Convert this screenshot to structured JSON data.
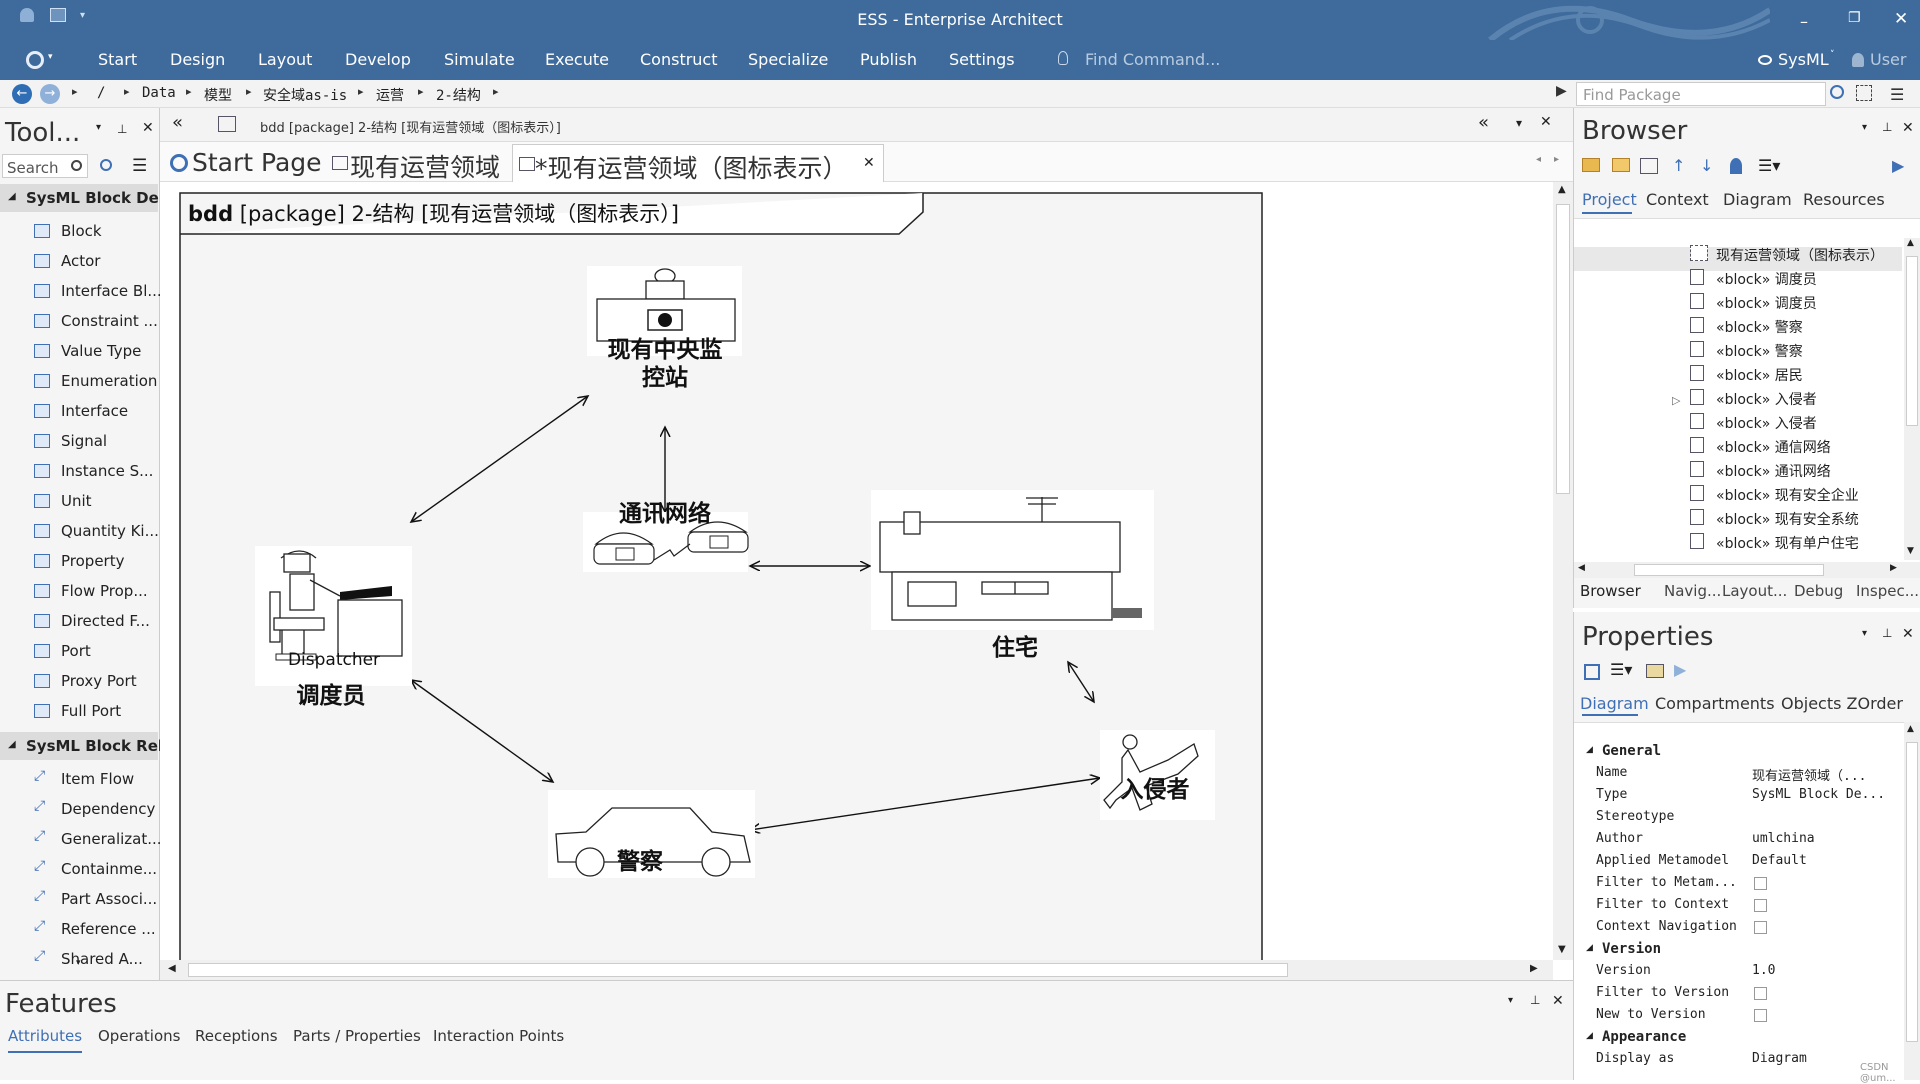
{
  "window": {
    "title": "ESS - Enterprise Architect"
  },
  "menu": {
    "items": [
      "Start",
      "Design",
      "Layout",
      "Develop",
      "Simulate",
      "Execute",
      "Construct",
      "Specialize",
      "Publish",
      "Settings"
    ],
    "find_command_placeholder": "Find Command...",
    "perspective": "SysML",
    "user": "User"
  },
  "breadcrumb": {
    "items": [
      "/",
      "Data",
      "模型",
      "安全域as-is",
      "运营",
      "2-结构"
    ]
  },
  "find_package": {
    "placeholder": "Find Package"
  },
  "toolbox": {
    "title": "Tool...",
    "search_placeholder": "Search",
    "section1": "SysML Block De...",
    "items1": [
      "Block",
      "Actor",
      "Interface Bl...",
      "Constraint ...",
      "Value Type",
      "Enumeration",
      "Interface",
      "Signal",
      "Instance S...",
      "Unit",
      "Quantity Ki...",
      "Property",
      "Flow Prop...",
      "Directed F...",
      "Port",
      "Proxy Port",
      "Full Port"
    ],
    "section2": "SysML Block Rel...",
    "items2": [
      "Item Flow",
      "Dependency",
      "Generalizat...",
      "Containme...",
      "Part Associ...",
      "Reference ...",
      "Shared A..."
    ]
  },
  "diagram_header": {
    "title": "bdd [package] 2-结构 [现有运营领域（图标表示）]"
  },
  "tabs": [
    {
      "label": "Start Page"
    },
    {
      "label": "现有运营领域"
    },
    {
      "label": "*现有运营领域（图标表示）"
    }
  ],
  "diagram": {
    "frame_label_bold": "bdd",
    "frame_label_rest": " [package] 2-结构 [现有运营领域（图标表示）]",
    "nodes": {
      "monitor": "现有中央监\n控站",
      "network": "通讯网络",
      "dispatcher_caption": "Dispatcher",
      "dispatcher": "调度员",
      "house": "住宅",
      "police": "警察",
      "intruder": "入侵者"
    }
  },
  "browser": {
    "title": "Browser",
    "tabs": [
      "Project",
      "Context",
      "Diagram",
      "Resources"
    ],
    "items": [
      "现有运营领域（图标表示）",
      "«block» 调度员",
      "«block» 调度员",
      "«block» 警察",
      "«block» 警察",
      "«block» 居民",
      "«block» 入侵者",
      "«block» 入侵者",
      "«block» 通信网络",
      "«block» 通讯网络",
      "«block» 现有安全企业",
      "«block» 现有安全系统",
      "«block» 现有单户住宅"
    ],
    "bottom_tabs": [
      "Browser",
      "Navig...",
      "Layout...",
      "Debug",
      "Inspec..."
    ]
  },
  "properties": {
    "title": "Properties",
    "tabs": [
      "Diagram",
      "Compartments",
      "Objects ZOrder"
    ],
    "sections": [
      {
        "name": "General",
        "rows": [
          {
            "k": "Name",
            "v": "现有运营领域（..."
          },
          {
            "k": "Type",
            "v": "SysML Block De..."
          },
          {
            "k": "Stereotype",
            "v": ""
          },
          {
            "k": "Author",
            "v": "umlchina"
          },
          {
            "k": "Applied Metamodel",
            "v": "Default"
          },
          {
            "k": "Filter to Metam...",
            "v": "",
            "check": true
          },
          {
            "k": "Filter to Context",
            "v": "",
            "check": true
          },
          {
            "k": "Context Navigation",
            "v": "",
            "check": true
          }
        ]
      },
      {
        "name": "Version",
        "rows": [
          {
            "k": "Version",
            "v": "1.0"
          },
          {
            "k": "Filter to Version",
            "v": "",
            "check": true
          },
          {
            "k": "New to Version",
            "v": "",
            "check": true
          }
        ]
      },
      {
        "name": "Appearance",
        "rows": [
          {
            "k": "Display as",
            "v": "Diagram"
          }
        ]
      }
    ]
  },
  "features": {
    "title": "Features",
    "tabs": [
      "Attributes",
      "Operations",
      "Receptions",
      "Parts / Properties",
      "Interaction Points"
    ]
  },
  "watermark": "CSDN @um..."
}
